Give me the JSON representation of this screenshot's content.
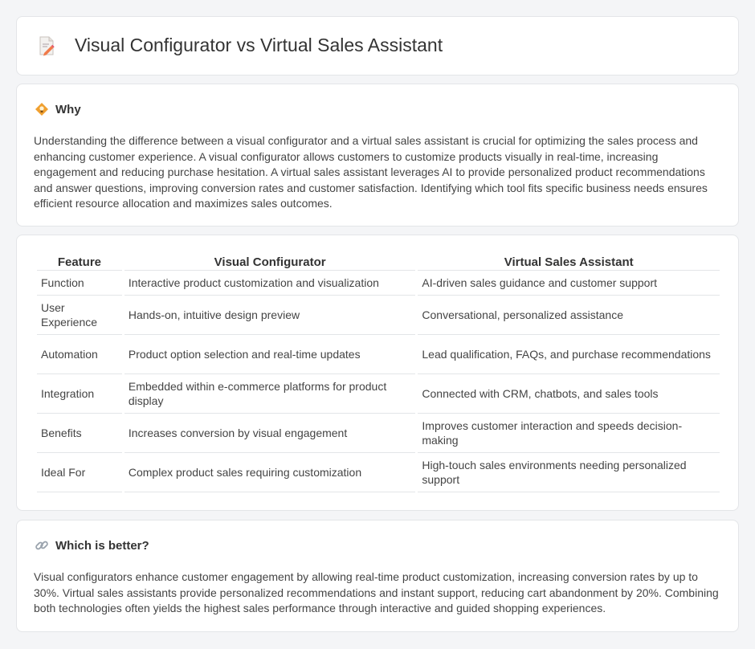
{
  "header": {
    "title": "Visual Configurator vs Virtual Sales Assistant",
    "icon": "document-pencil-icon"
  },
  "why": {
    "icon": "lightbulb-icon",
    "heading": "Why",
    "text": "Understanding the difference between a visual configurator and a virtual sales assistant is crucial for optimizing the sales process and enhancing customer experience. A visual configurator allows customers to customize products visually in real-time, increasing engagement and reducing purchase hesitation. A virtual sales assistant leverages AI to provide personalized product recommendations and answer questions, improving conversion rates and customer satisfaction. Identifying which tool fits specific business needs ensures efficient resource allocation and maximizes sales outcomes."
  },
  "table": {
    "headers": [
      "Feature",
      "Visual Configurator",
      "Virtual Sales Assistant"
    ],
    "rows": [
      [
        "Function",
        "Interactive product customization and visualization",
        "AI-driven sales guidance and customer support"
      ],
      [
        "User Experience",
        "Hands-on, intuitive design preview",
        "Conversational, personalized assistance"
      ],
      [
        "Automation",
        "Product option selection and real-time updates",
        "Lead qualification, FAQs, and purchase recommendations"
      ],
      [
        "Integration",
        "Embedded within e-commerce platforms for product display",
        "Connected with CRM, chatbots, and sales tools"
      ],
      [
        "Benefits",
        "Increases conversion by visual engagement",
        "Improves customer interaction and speeds decision-making"
      ],
      [
        "Ideal For",
        "Complex product sales requiring customization",
        "High-touch sales environments needing personalized support"
      ]
    ]
  },
  "better": {
    "icon": "link-icon",
    "heading": "Which is better?",
    "text": "Visual configurators enhance customer engagement by allowing real-time product customization, increasing conversion rates by up to 30%. Virtual sales assistants provide personalized recommendations and instant support, reducing cart abandonment by 20%. Combining both technologies often yields the highest sales performance through interactive and guided shopping experiences."
  },
  "colors": {
    "background": "#f4f5f7",
    "card": "#ffffff",
    "border": "#e3e5e8",
    "icon_orange": "#f0a030"
  }
}
